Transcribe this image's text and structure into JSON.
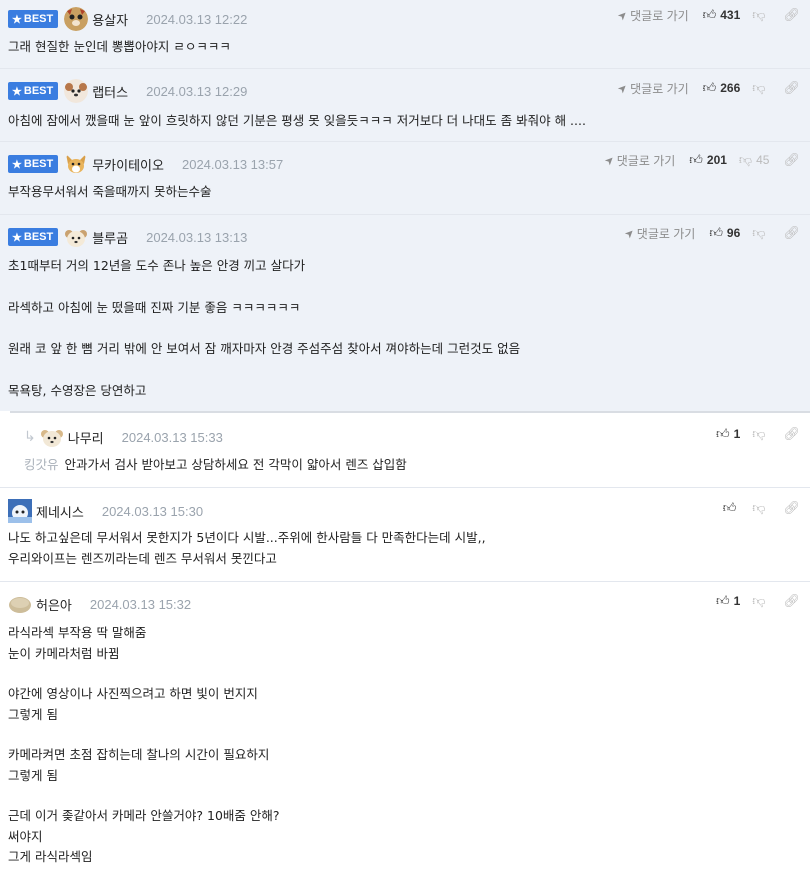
{
  "ui": {
    "goto_label": "댓글로 가기",
    "best_label": "BEST"
  },
  "comments": [
    {
      "nick": "용살자",
      "date": "2024.03.13 12:22",
      "best": true,
      "up": "431",
      "down": "",
      "lines": [
        "그래 현질한 눈인데 뽕뽑아야지 ㄹㅇㅋㅋㅋ"
      ]
    },
    {
      "nick": "랩터스",
      "date": "2024.03.13 12:29",
      "best": true,
      "up": "266",
      "down": "",
      "lines": [
        "아침에 잠에서 깼을때 눈 앞이 흐릿하지 않던 기분은 평생 못 잊을듯ㅋㅋㅋ 저거보다 더 나대도 좀 봐줘야 해 ...."
      ]
    },
    {
      "nick": "무카이테이오",
      "date": "2024.03.13 13:57",
      "best": true,
      "up": "201",
      "down": "45",
      "lines": [
        "부작용무서워서 죽을때까지 못하는수술"
      ]
    },
    {
      "nick": "블루곰",
      "date": "2024.03.13 13:13",
      "best": true,
      "up": "96",
      "down": "",
      "lines": [
        "초1때부터 거의 12년을 도수 존나 높은 안경 끼고 살다가",
        "",
        "라섹하고 아침에 눈 떴을때 진짜 기분 좋음 ㅋㅋㅋㅋㅋㅋ",
        "",
        "원래 코 앞 한 뼘 거리 밖에 안 보여서 잠 깨자마자 안경 주섬주섬 찾아서 껴야하는데 그런것도 없음",
        "",
        "목욕탕, 수영장은 당연하고"
      ]
    },
    {
      "nick": "나무리",
      "date": "2024.03.13 15:33",
      "best": false,
      "reply": true,
      "mention": "킹갓유",
      "up": "1",
      "down": "",
      "lines": [
        "안과가서 검사 받아보고 상담하세요 전 각막이 얇아서 렌즈 삽입함"
      ]
    },
    {
      "nick": "제네시스",
      "date": "2024.03.13 15:30",
      "best": false,
      "up": "",
      "down": "",
      "lines": [
        "나도 하고싶은데 무서워서 못한지가 5년이다 시발...주위에 한사람들 다 만족한다는데 시발,,",
        "우리와이프는 렌즈끼라는데 렌즈 무서워서 못낀다고"
      ]
    },
    {
      "nick": "허은아",
      "date": "2024.03.13 15:32",
      "best": false,
      "up": "1",
      "down": "",
      "lines": [
        "라식라섹 부작용 딱 말해줌",
        "눈이 카메라처럼 바뀜",
        "",
        "야간에 영상이나 사진찍으려고 하면 빛이 번지지",
        "그렇게 됨",
        "",
        "카메라켜면 초점 잡히는데 찰나의 시간이 필요하지",
        "그렇게 됨",
        "",
        "근데 이거 좆같아서 카메라 안쓸거야? 10배줌 안해?",
        "써야지",
        "그게 라식라섹임"
      ]
    }
  ],
  "icons": {
    "goto": "send-arrow-icon",
    "up": "thumbs-up-icon",
    "down": "thumbs-down-icon",
    "link": "link-icon",
    "reply": "reply-arrow-icon",
    "star": "star-icon"
  },
  "colors": {
    "best_badge": "#3a7de0",
    "best_row_bg": "#eef2f8"
  }
}
